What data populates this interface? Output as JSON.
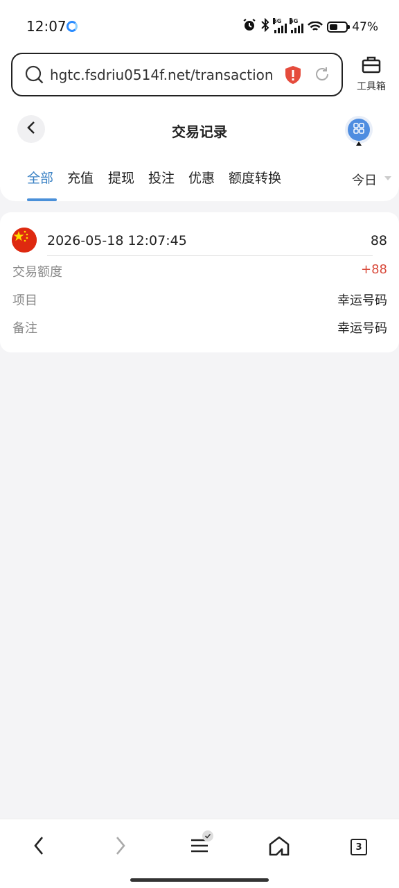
{
  "status_bar": {
    "time": "12:07",
    "battery": "47%",
    "network_1": "5G",
    "network_2": "5G",
    "icons": [
      "alarm-icon",
      "bluetooth-icon",
      "signal-icon",
      "signal-icon",
      "wifi-icon",
      "battery-icon"
    ]
  },
  "browser": {
    "url": "hgtc.fsdriu0514f.net/transaction",
    "toolbox_label": "工具箱",
    "open_tabs": "3"
  },
  "header": {
    "title": "交易记录"
  },
  "tabs": [
    {
      "label": "全部",
      "active": true
    },
    {
      "label": "充值",
      "active": false
    },
    {
      "label": "提现",
      "active": false
    },
    {
      "label": "投注",
      "active": false
    },
    {
      "label": "优惠",
      "active": false
    },
    {
      "label": "额度转换",
      "active": false
    }
  ],
  "filter": {
    "date": "今日"
  },
  "records": [
    {
      "datetime": "2026-05-18 12:07:45",
      "amount": "88",
      "fields": [
        {
          "label": "交易额度",
          "value": "+88"
        },
        {
          "label": "项目",
          "value": "幸运号码"
        },
        {
          "label": "备注",
          "value": "幸运号码"
        }
      ]
    }
  ],
  "colors": {
    "accent": "#3b82c4",
    "positive": "#d94a3b",
    "background": "#f4f4f6"
  }
}
